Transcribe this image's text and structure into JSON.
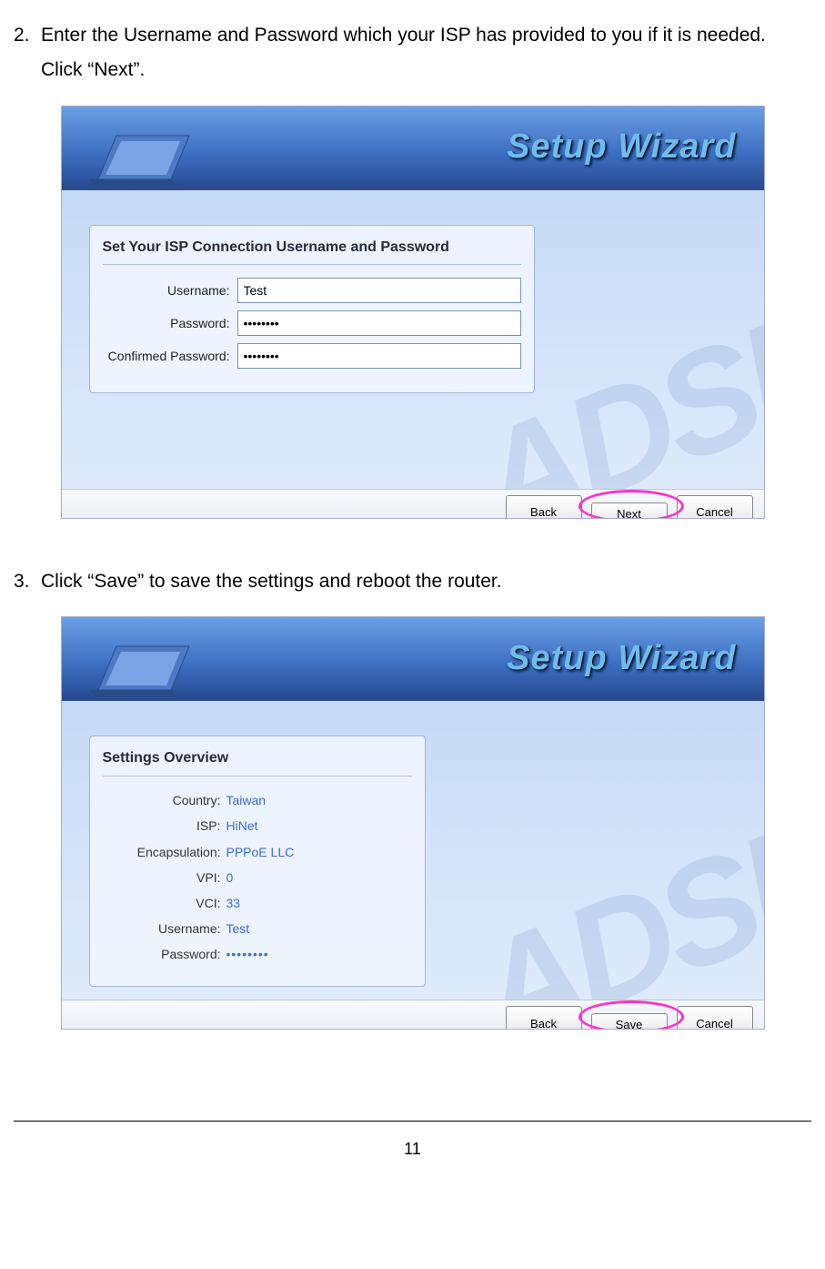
{
  "steps": {
    "s2": {
      "num": "2.",
      "text": "Enter the Username and Password which your ISP has provided to you if it is needed. Click “Next”."
    },
    "s3": {
      "num": "3.",
      "text": "Click “Save” to save the settings and reboot the router."
    }
  },
  "wizard_title": "Setup Wizard",
  "watermark": "ADSL",
  "screen1": {
    "panel_title": "Set Your ISP Connection Username and Password",
    "username_label": "Username:",
    "username_value": "Test",
    "password_label": "Password:",
    "password_value": "••••••••",
    "confirm_label": "Confirmed Password:",
    "confirm_value": "••••••••",
    "buttons": {
      "back": "Back",
      "next": "Next",
      "cancel": "Cancel"
    }
  },
  "screen2": {
    "panel_title": "Settings Overview",
    "rows": {
      "country": {
        "label": "Country:",
        "value": "Taiwan"
      },
      "isp": {
        "label": "ISP:",
        "value": "HiNet"
      },
      "encap": {
        "label": "Encapsulation:",
        "value": "PPPoE LLC"
      },
      "vpi": {
        "label": "VPI:",
        "value": "0"
      },
      "vci": {
        "label": "VCI:",
        "value": "33"
      },
      "user": {
        "label": "Username:",
        "value": "Test"
      },
      "pwd": {
        "label": "Password:",
        "value": "••••••••"
      }
    },
    "buttons": {
      "back": "Back",
      "save": "Save",
      "cancel": "Cancel"
    }
  },
  "page_number": "11"
}
